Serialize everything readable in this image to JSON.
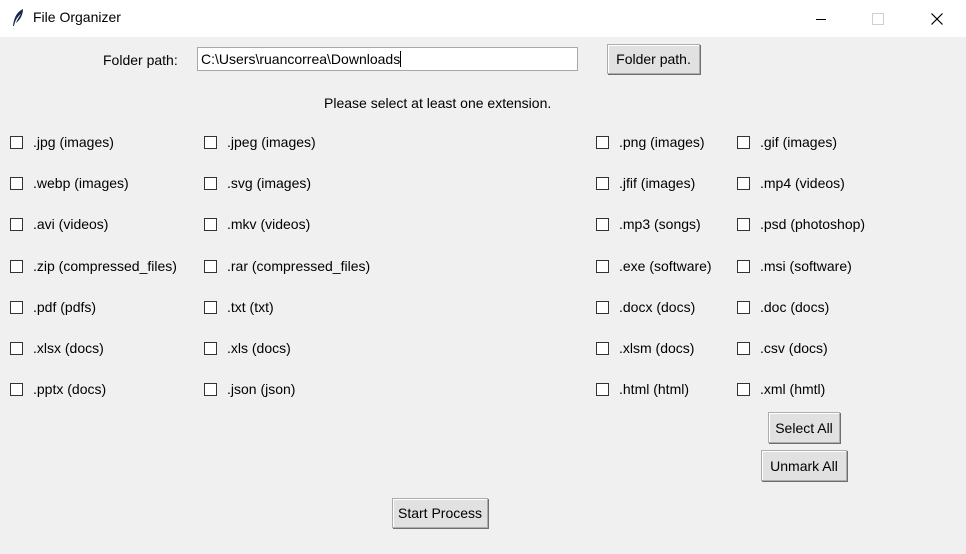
{
  "window": {
    "title": "File Organizer",
    "icon": "feather-icon"
  },
  "folder": {
    "label": "Folder path:",
    "value": "C:\\Users\\ruancorrea\\Downloads",
    "button_label": "Folder path."
  },
  "message": "Please select at least one extension.",
  "extensions": {
    "col1": [
      ".jpg (images)",
      ".webp (images)",
      ".avi (videos)",
      ".zip (compressed_files)",
      ".pdf (pdfs)",
      ".xlsx (docs)",
      ".pptx (docs)"
    ],
    "col2": [
      ".jpeg (images)",
      ".svg (images)",
      ".mkv (videos)",
      ".rar (compressed_files)",
      ".txt (txt)",
      ".xls (docs)",
      ".json (json)"
    ],
    "col3": [
      ".png (images)",
      ".jfif (images)",
      ".mp3 (songs)",
      ".exe (software)",
      ".docx (docs)",
      ".xlsm (docs)",
      ".html (html)"
    ],
    "col4": [
      ".gif (images)",
      ".mp4 (videos)",
      ".psd (photoshop)",
      ".msi (software)",
      ".doc (docs)",
      ".csv (docs)",
      ".xml (hmtl)"
    ]
  },
  "buttons": {
    "select_all": "Select All",
    "unmark_all": "Unmark All",
    "start": "Start Process"
  }
}
